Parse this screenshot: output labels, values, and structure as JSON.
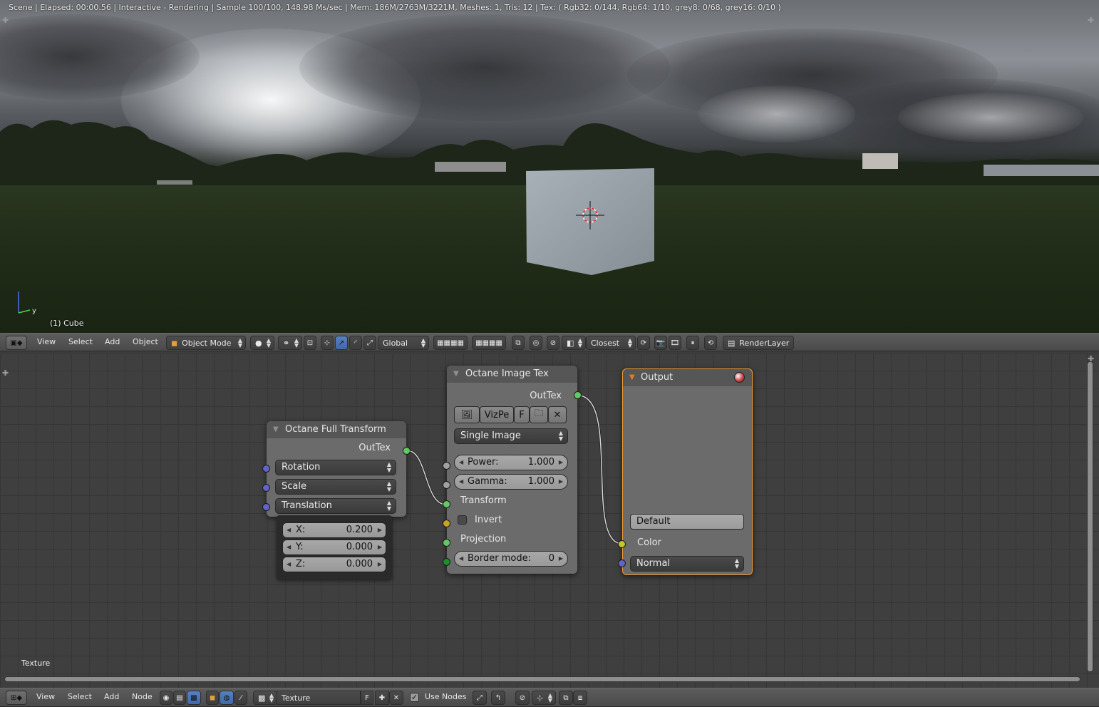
{
  "viewport": {
    "status_line": "Scene | Elapsed: 00:00.56 | Interactive - Rendering | Sample 100/100, 148.98 Ms/sec | Mem: 186M/2763M/3221M, Meshes: 1, Tris: 12 | Tex: ( Rgb32: 0/144, Rgb64: 1/10, grey8: 0/68, grey16: 0/10 )",
    "object_label": "(1) Cube",
    "axis_y_label": "y"
  },
  "viewport_header": {
    "menus": [
      "View",
      "Select",
      "Add",
      "Object"
    ],
    "mode": "Object Mode",
    "orientation": "Global",
    "snap_target": "Closest",
    "render_layer": "RenderLayer"
  },
  "nodes": {
    "full_transform": {
      "title": "Octane Full Transform",
      "output": "OutTex",
      "rotation": "Rotation",
      "scale": "Scale",
      "translation": "Translation",
      "x_label": "X:",
      "x_value": "0.200",
      "y_label": "Y:",
      "y_value": "0.000",
      "z_label": "Z:",
      "z_value": "0.000"
    },
    "image_tex": {
      "title": "Octane Image Tex",
      "output": "OutTex",
      "image_name": "VizPe",
      "fake_user": "F",
      "source": "Single Image",
      "power_label": "Power:",
      "power_value": "1.000",
      "gamma_label": "Gamma:",
      "gamma_value": "1.000",
      "transform": "Transform",
      "invert": "Invert",
      "projection": "Projection",
      "border_label": "Border mode:",
      "border_value": "0"
    },
    "output": {
      "title": "Output",
      "default": "Default",
      "color": "Color",
      "normal": "Normal"
    }
  },
  "node_area": {
    "label": "Texture"
  },
  "node_header": {
    "menus": [
      "View",
      "Select",
      "Add",
      "Node"
    ],
    "texture_name": "Texture",
    "fake_user": "F",
    "use_nodes": "Use Nodes"
  },
  "colors": {
    "accent_selected": "#4169a9",
    "active_node_border": "#ec9a33",
    "socket_green": "#63c763",
    "socket_purple": "#6363c7",
    "socket_yellow": "#c7c729"
  }
}
